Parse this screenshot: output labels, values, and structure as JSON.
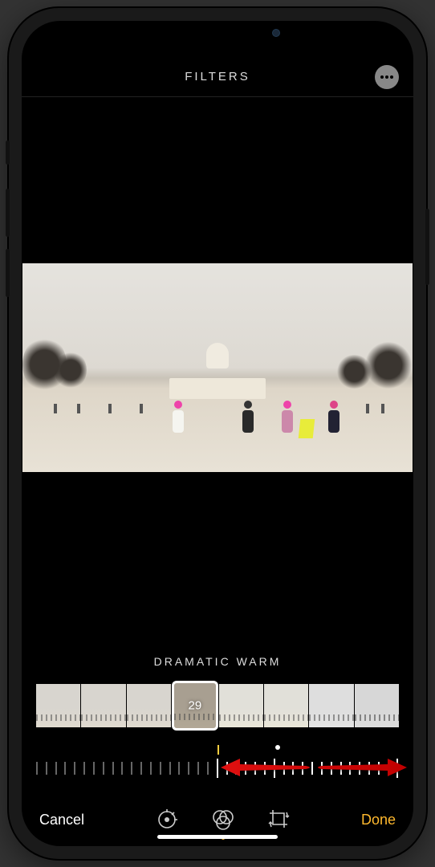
{
  "header": {
    "title": "FILTERS"
  },
  "filter": {
    "name": "DRAMATIC WARM",
    "intensity": 29
  },
  "actions": {
    "cancel": "Cancel",
    "done": "Done"
  },
  "tools": {
    "adjust": "adjust",
    "filters": "filters",
    "crop": "crop",
    "active": "filters"
  },
  "annotation": {
    "type": "double-arrow",
    "hint": "drag-slider"
  }
}
